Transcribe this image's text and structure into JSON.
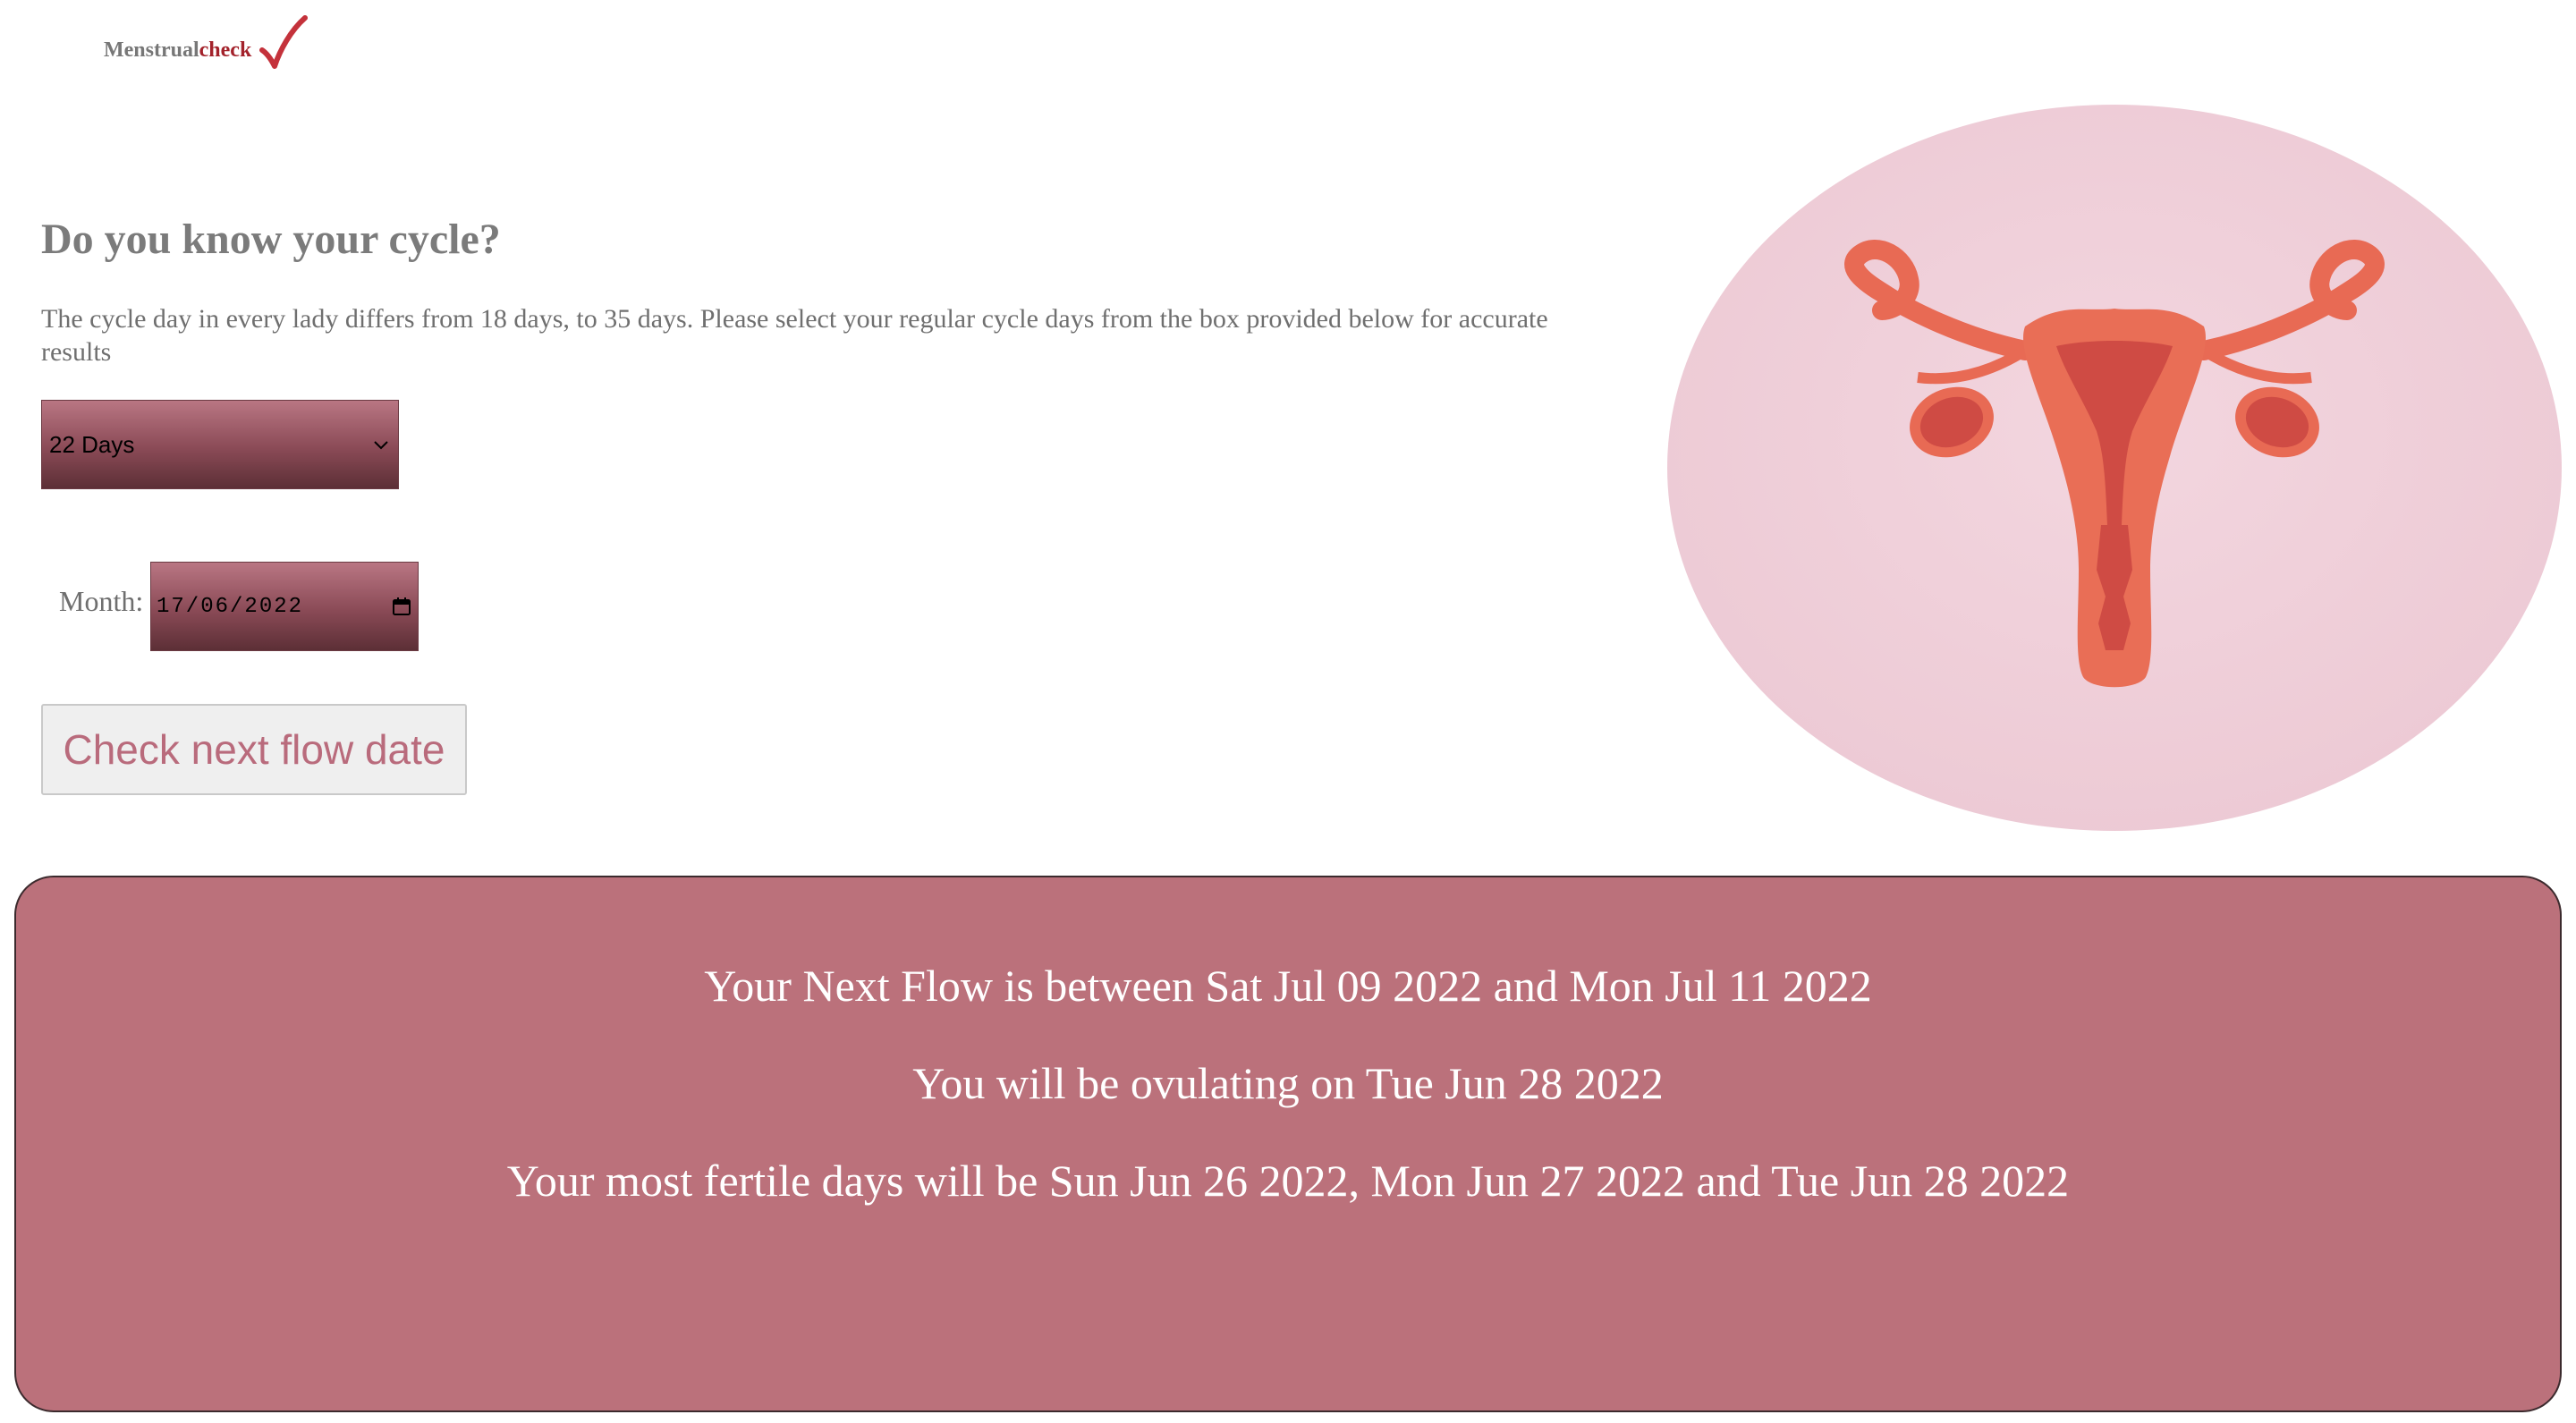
{
  "logo": {
    "text_main": "Menstrual",
    "text_accent": "check",
    "icon": "checkmark-icon"
  },
  "form": {
    "heading": "Do you know your cycle?",
    "intro": "The cycle day in every lady differs from 18 days, to 35 days. Please select your regular cycle days from the box provided below for accurate results",
    "cycle_select": {
      "selected": "22 Days",
      "icon": "chevron-down-icon"
    },
    "month_label": "Month:",
    "date_input": {
      "value": "17/06/2022",
      "icon": "calendar-icon"
    },
    "submit_label": "Check next flow date"
  },
  "illustration": {
    "icon": "uterus-illustration"
  },
  "results": {
    "next_flow": "Your Next Flow is between Sat Jul 09 2022 and Mon Jul 11 2022",
    "ovulation": "You will be ovulating on Tue Jun 28 2022",
    "fertile_days": "Your most fertile days will be Sun Jun 26 2022, Mon Jun 27 2022 and Tue Jun 28 2022"
  },
  "colors": {
    "brand": "#a3222b",
    "panel": "#bb717b",
    "button_text": "#b96b7c",
    "text_gray": "#7b7b7b"
  }
}
